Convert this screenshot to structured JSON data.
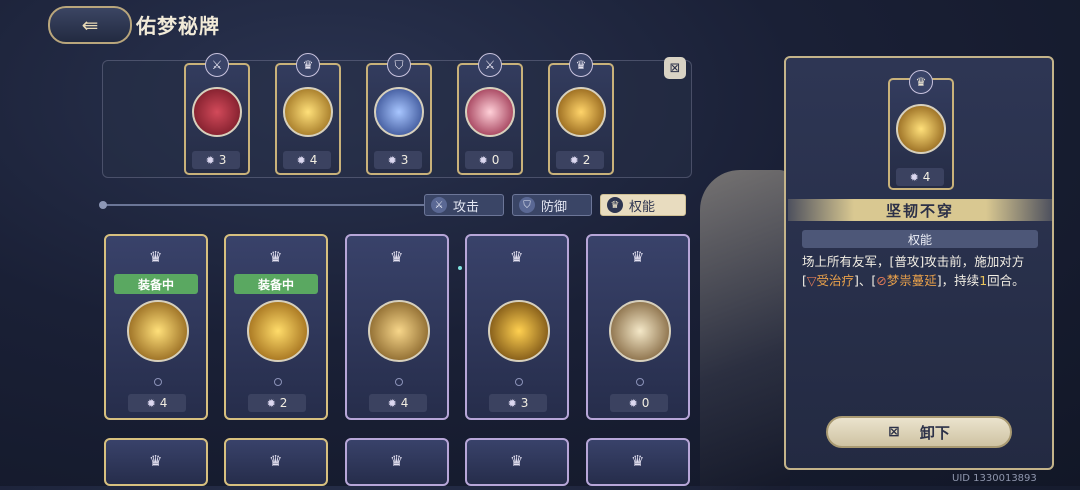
{
  "header": {
    "back_icon": "back-arrow-icon",
    "title": "佑梦秘牌"
  },
  "equipped": [
    {
      "type_icon": "sword-icon",
      "cost": "3",
      "color": "#8e1c2a"
    },
    {
      "type_icon": "crown-icon",
      "cost": "4",
      "color": "#c8951c"
    },
    {
      "type_icon": "shield-icon",
      "cost": "3",
      "color": "#3b5fb8"
    },
    {
      "type_icon": "sword-icon",
      "cost": "0",
      "color": "#a0284a"
    },
    {
      "type_icon": "crown-icon",
      "cost": "2",
      "color": "#c9861a"
    }
  ],
  "tabs": [
    {
      "label": "攻击",
      "icon": "sword-icon",
      "active": false
    },
    {
      "label": "防御",
      "icon": "shield-icon",
      "active": false
    },
    {
      "label": "权能",
      "icon": "crown-icon",
      "active": true
    }
  ],
  "cards": [
    {
      "badge": "装备中",
      "cost": "4",
      "color": "#c98f1e"
    },
    {
      "badge": "装备中",
      "cost": "2",
      "color": "#d49a1a"
    },
    {
      "badge": "",
      "cost": "4",
      "color": "#b98a2a"
    },
    {
      "badge": "",
      "cost": "3",
      "color": "#c28019"
    },
    {
      "badge": "",
      "cost": "0",
      "color": "#d9c59a"
    }
  ],
  "detail": {
    "cost": "4",
    "name": "坚韧不穿",
    "type": "权能",
    "desc_1": "场上所有友军，[普攻]攻击前，施加对方[",
    "desc_heal": "受治疗",
    "desc_2": "]、[",
    "desc_dream": "梦祟蔓延",
    "desc_3": "]，持续",
    "desc_num": "1",
    "desc_4": "回合。",
    "remove_label": "卸下"
  },
  "uid": "UID 1330013893"
}
